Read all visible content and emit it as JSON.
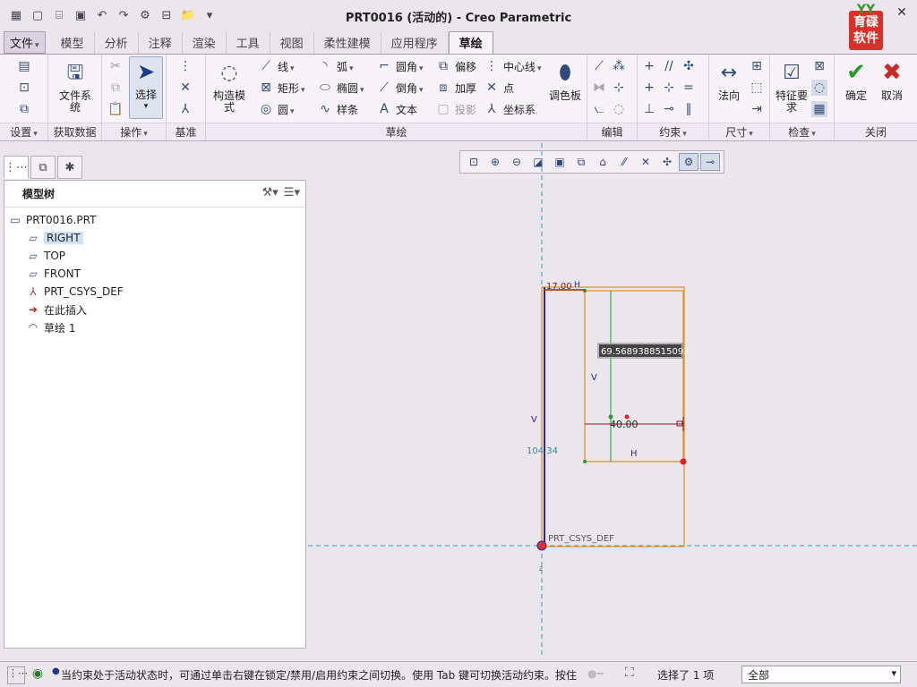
{
  "window": {
    "title": "PRT0016 (活动的) - Creo Parametric",
    "logo_top": "YY",
    "logo_text": "育碟软件"
  },
  "quick_access": [
    "new-icon",
    "open-icon",
    "save-icon",
    "undo-icon",
    "redo-icon",
    "regenerate-icon",
    "window-icon",
    "folder-icon",
    "customize-icon"
  ],
  "tabs": [
    "文件",
    "模型",
    "分析",
    "注释",
    "渲染",
    "工具",
    "视图",
    "柔性建模",
    "应用程序",
    "草绘"
  ],
  "active_tab": "草绘",
  "ribbon": {
    "groups": {
      "setup": "设置",
      "get_data": "获取数据",
      "operations": "操作",
      "datum": "基准",
      "sketching": "草绘",
      "editing": "编辑",
      "constrain": "约束",
      "dimension": "尺寸",
      "inspect": "检查",
      "close": "关闭"
    },
    "file_system": "文件系统",
    "select": "选择",
    "construction_mode": "构造模式",
    "line": "线",
    "rectangle": "矩形",
    "circle": "圆",
    "arc": "弧",
    "ellipse": "椭圆",
    "spline": "样条",
    "fillet": "圆角",
    "chamfer": "倒角",
    "text": "文本",
    "offset": "偏移",
    "thicken": "加厚",
    "project": "投影",
    "centerline": "中心线",
    "point": "点",
    "coordinate_system": "坐标系",
    "palette": "调色板",
    "normal": "法向",
    "feature_requirements": "特征要求",
    "ok": "确定",
    "cancel": "取消"
  },
  "model_tree": {
    "title": "模型树",
    "items": [
      {
        "label": "PRT0016.PRT",
        "icon": "part-icon",
        "selected": false
      },
      {
        "label": "RIGHT",
        "icon": "datum-plane-icon",
        "selected": true
      },
      {
        "label": "TOP",
        "icon": "datum-plane-icon",
        "selected": false
      },
      {
        "label": "FRONT",
        "icon": "datum-plane-icon",
        "selected": false
      },
      {
        "label": "PRT_CSYS_DEF",
        "icon": "csys-icon",
        "selected": false
      },
      {
        "label": "在此插入",
        "icon": "insert-arrow-icon",
        "selected": false
      },
      {
        "label": "草绘 1",
        "icon": "sketch-icon",
        "selected": false
      }
    ]
  },
  "sketch": {
    "dim_top": "17.00",
    "dim_height": "104.34",
    "dim_width": "40.00",
    "edit_value": "69.5689388515092",
    "csys_label": "PRT_CSYS_DEF",
    "label_v1": "V",
    "label_v2": "V",
    "label_h1": "H",
    "label_h2": "H",
    "axis_z": "z",
    "colors": {
      "sketch_line": "#d9902a",
      "centerline": "#2aa7b5",
      "dimension": "#8b1a1a",
      "constraint": "#2a2aa0",
      "weak_dim": "#2a8aa0"
    }
  },
  "status": {
    "message": "当约束处于活动状态时，可通过单击右键在锁定/禁用/启用约束之间切换。使用 Tab 键可切换活动约束。按住",
    "selection": "选择了 1 项",
    "filter": "全部"
  }
}
